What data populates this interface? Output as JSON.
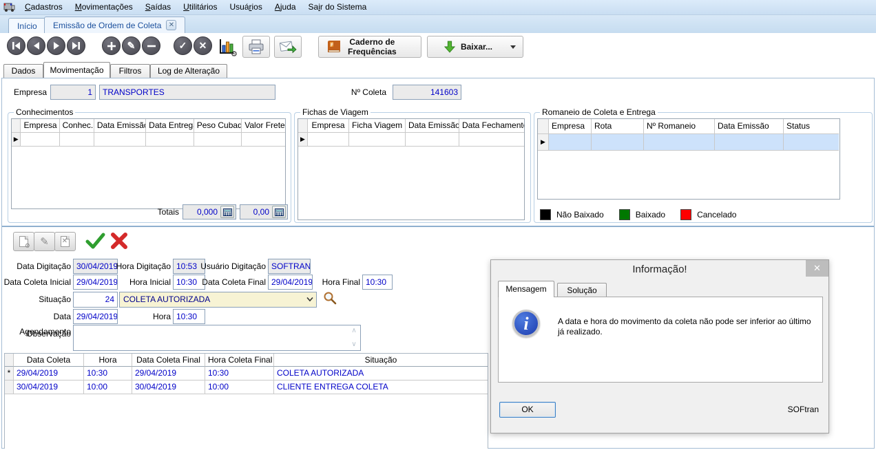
{
  "icons": {
    "close": "✕",
    "gear": "⚙",
    "pencil": "✎",
    "row_marker": "▶",
    "up_arrow": "∧",
    "down_arrow": "∨"
  },
  "menu": {
    "items": [
      {
        "label": "Cadastros",
        "accel": "0"
      },
      {
        "label": "Movimentações",
        "accel": "0"
      },
      {
        "label": "Saídas",
        "accel": "0"
      },
      {
        "label": "Utilitários",
        "accel": "0"
      },
      {
        "label": "Usuários",
        "accel": "4"
      },
      {
        "label": "Ajuda",
        "accel": "0"
      },
      {
        "label": "Sair do Sistema",
        "accel": "2"
      }
    ]
  },
  "page_tabs": {
    "home": "Início",
    "current": "Emissão de Ordem de Coleta"
  },
  "toolbar": {
    "caderno_line1": "Caderno de",
    "caderno_line2": "Frequências",
    "baixar": "Baixar..."
  },
  "subtabs": {
    "items": [
      "Dados",
      "Movimentação",
      "Filtros",
      "Log de Alteração"
    ]
  },
  "header_form": {
    "empresa_label": "Empresa",
    "empresa_code": "1",
    "empresa_name": "TRANSPORTES",
    "ncoleta_label": "Nº Coleta",
    "ncoleta_value": "141603"
  },
  "conhecimentos": {
    "title": "Conhecimentos",
    "columns": [
      "Empresa",
      "Conhec.",
      "Data Emissão",
      "Data Entrega",
      "Peso Cubado",
      "Valor Frete"
    ],
    "totais_label": "Totais",
    "total_peso": "0,000",
    "total_frete": "0,00"
  },
  "fichas": {
    "title": "Fichas de Viagem",
    "columns": [
      "Empresa",
      "Ficha Viagem",
      "Data Emissão",
      "Data Fechamento"
    ]
  },
  "romaneio": {
    "title": "Romaneio de Coleta e Entrega",
    "columns": [
      "Empresa",
      "Rota",
      "Nº Romaneio",
      "Data Emissão",
      "Status"
    ],
    "legend": [
      {
        "label": "Não Baixado",
        "color": "#000000"
      },
      {
        "label": "Baixado",
        "color": "#007800"
      },
      {
        "label": "Cancelado",
        "color": "#ff0000"
      }
    ]
  },
  "movement_form": {
    "data_digitacao_label": "Data Digitação",
    "data_digitacao": "30/04/2019",
    "hora_digitacao_label": "Hora Digitação",
    "hora_digitacao": "10:53",
    "usuario_label": "Usuário Digitação",
    "usuario": "SOFTRAN",
    "data_coleta_inicial_label": "Data Coleta Inicial",
    "data_coleta_inicial": "29/04/2019",
    "hora_inicial_label": "Hora Inicial",
    "hora_inicial": "10:30",
    "data_coleta_final_label": "Data Coleta Final",
    "data_coleta_final": "29/04/2019",
    "hora_final_label": "Hora Final",
    "hora_final": "10:30",
    "situacao_label": "Situação",
    "situacao_code": "24",
    "situacao_value": "COLETA AUTORIZADA",
    "data_agendamento_label": "Data Agendamento",
    "data_agendamento": "29/04/2019",
    "hora_label": "Hora",
    "hora": "10:30",
    "observacao_label": "Observação",
    "observacao": ""
  },
  "movements_grid": {
    "columns": [
      "Data Coleta",
      "Hora",
      "Data Coleta Final",
      "Hora Coleta Final",
      "Situação"
    ],
    "rows": [
      {
        "marker": "*",
        "cells": [
          "29/04/2019",
          "10:30",
          "29/04/2019",
          "10:30",
          "COLETA AUTORIZADA"
        ]
      },
      {
        "marker": "",
        "cells": [
          "30/04/2019",
          "10:00",
          "30/04/2019",
          "10:00",
          "CLIENTE ENTREGA COLETA"
        ]
      }
    ]
  },
  "dialog": {
    "title": "Informação!",
    "tab_mensagem": "Mensagem",
    "tab_solucao": "Solução",
    "message": "A data e hora do movimento da coleta não pode ser inferior ao último já realizado.",
    "ok": "OK",
    "brand": "SOFtran"
  }
}
